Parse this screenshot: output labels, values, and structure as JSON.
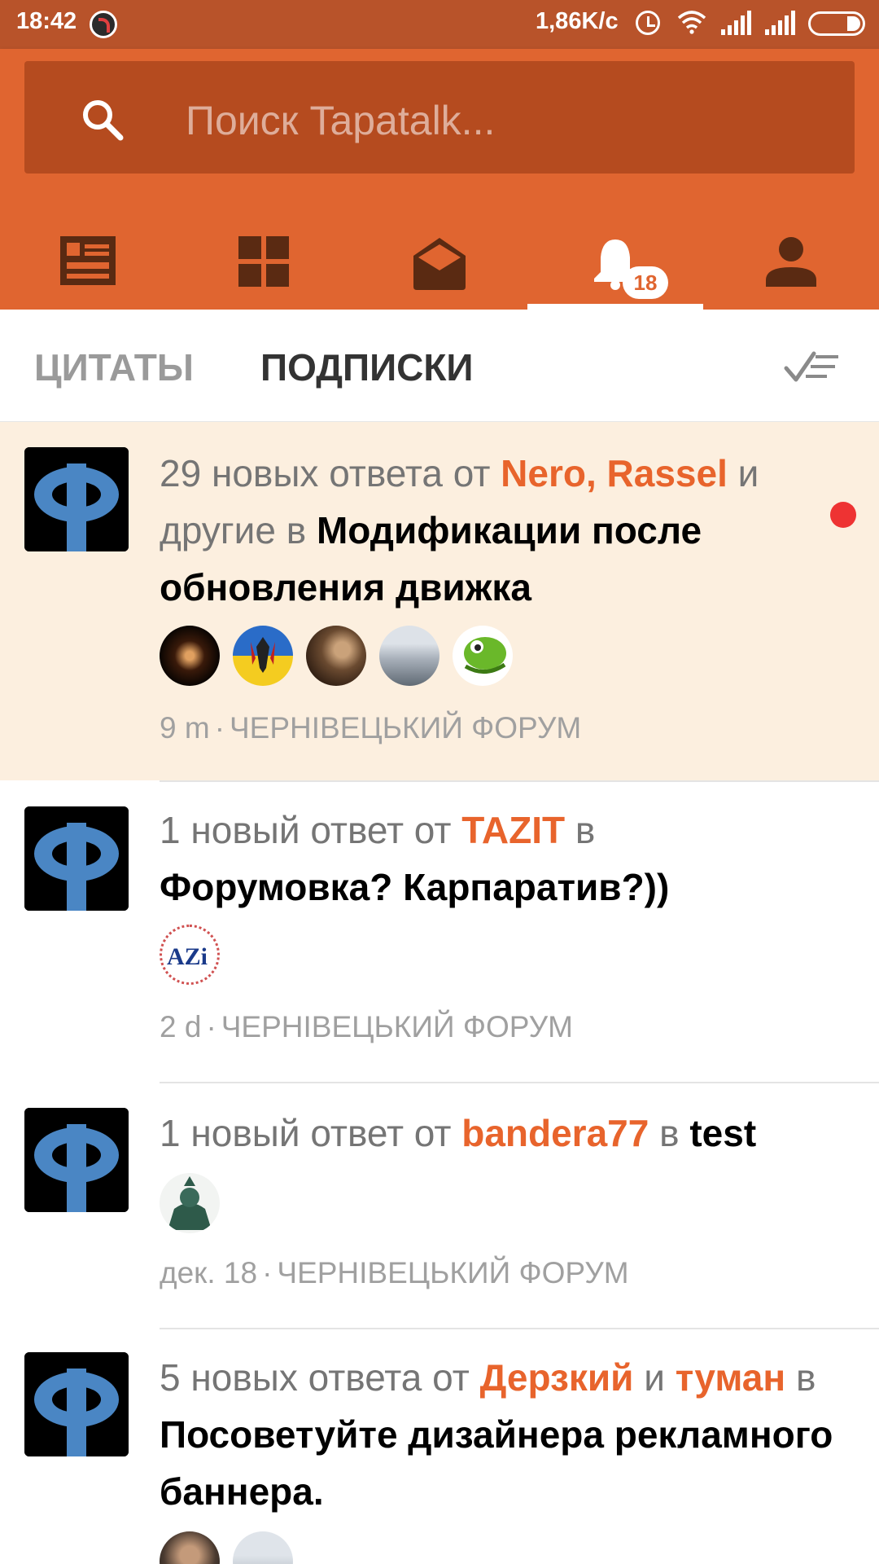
{
  "status_bar": {
    "time": "18:42",
    "net_speed": "1,86K/с"
  },
  "search": {
    "placeholder": "Поиск Tapatalk..."
  },
  "nav": {
    "tabs": [
      {
        "icon": "feed-icon"
      },
      {
        "icon": "forums-grid-icon"
      },
      {
        "icon": "messages-envelope-icon"
      },
      {
        "icon": "notifications-bell-icon",
        "badge": "18",
        "active": true
      },
      {
        "icon": "profile-icon"
      }
    ]
  },
  "sub_tabs": {
    "quotes": "ЦИТАТЫ",
    "subscriptions": "ПОДПИСКИ",
    "active": "subscriptions"
  },
  "colors": {
    "brand": "#e06530",
    "status_bar": "#b8532a",
    "unread_bg": "#fcefdf",
    "unread_dot": "#ee3333",
    "username": "#e8642c"
  },
  "feed": [
    {
      "count_text": "29 новых ответа от",
      "users": "Nero, Rassel",
      "middle": "и другие в",
      "thread": "Модификации после обновления движка",
      "time": "9 m",
      "forum": "ЧЕРНІВЕЦЬКИЙ ФОРУМ",
      "unread": true
    },
    {
      "count_text": "1 новый ответ от",
      "user": "TAZIT",
      "middle": "в",
      "thread": "Форумовка? Карпаратив?))",
      "time": "2 d",
      "forum": "ЧЕРНІВЕЦЬКИЙ ФОРУМ",
      "unread": false
    },
    {
      "count_text": "1 новый ответ от",
      "user": "bandera77",
      "middle": "в",
      "thread": "test",
      "time": "дек. 18",
      "forum": "ЧЕРНІВЕЦЬКИЙ ФОРУМ",
      "unread": false
    },
    {
      "count_text": "5 новых ответа от",
      "user1": "Дерзкий",
      "join": "и",
      "user2": "туман",
      "middle": "в",
      "thread": "Посоветуйте дизайнера рекламного баннера.",
      "unread": false
    }
  ]
}
